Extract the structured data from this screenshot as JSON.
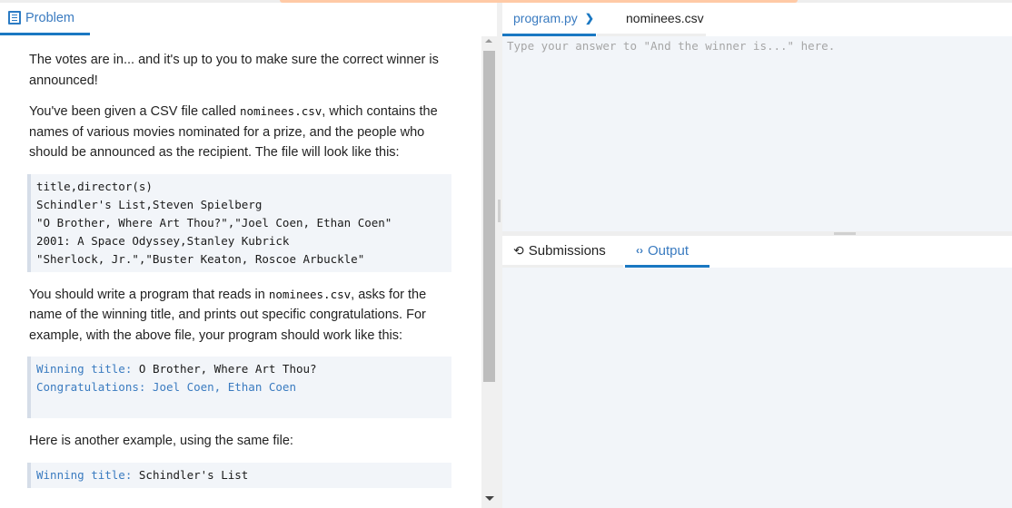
{
  "left_panel": {
    "tab": {
      "label": "Problem",
      "icon": "document-icon"
    },
    "paragraphs": {
      "p1": "The votes are in... and it's up to you to make sure the correct winner is announced!",
      "p2_a": "You've been given a CSV file called ",
      "p2_code": "nominees.csv",
      "p2_b": ", which contains the names of various movies nominated for a prize, and the people who should be announced as the recipient. The file will look like this:",
      "p3_a": "You should write a program that reads in ",
      "p3_code": "nominees.csv",
      "p3_b": ", asks for the name of the winning title, and prints out specific congratulations. For example, with the above file, your program should work like this:",
      "p4": "Here is another example, using the same file:"
    },
    "csv_lines": [
      "title,director(s)",
      "Schindler's List,Steven Spielberg",
      "\"O Brother, Where Art Thou?\",\"Joel Coen, Ethan Coen\"",
      "2001: A Space Odyssey,Stanley Kubrick",
      "\"Sherlock, Jr.\",\"Buster Keaton, Roscoe Arbuckle\""
    ],
    "example1": {
      "prompt": "Winning title: ",
      "input": "O Brother, Where Art Thou?",
      "output": "Congratulations: Joel Coen, Ethan Coen"
    },
    "example2": {
      "prompt": "Winning title: ",
      "input": "Schindler's List"
    }
  },
  "editor": {
    "tabs": [
      {
        "label": "program.py",
        "icon": "chevron-right-icon",
        "active": true
      },
      {
        "label": "nominees.csv",
        "active": false
      }
    ],
    "placeholder": "Type your answer to \"And the winner is...\" here."
  },
  "bottom_panel": {
    "tabs": [
      {
        "label": "Submissions",
        "icon": "history-icon",
        "active": false
      },
      {
        "label": "Output",
        "icon": "code-icon",
        "active": true
      }
    ]
  },
  "colors": {
    "accent": "#1a78c2",
    "link": "#3a7bc0",
    "code_bg": "#f2f5f9",
    "banner": "#ffcaa6"
  }
}
